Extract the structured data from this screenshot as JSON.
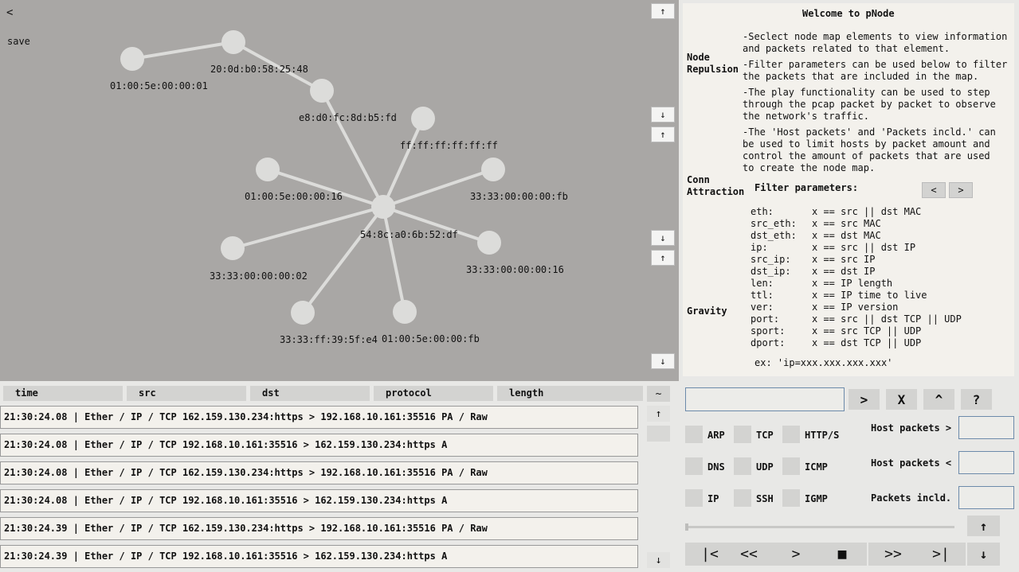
{
  "map": {
    "back_label": "<",
    "save_label": "save",
    "nodes": [
      {
        "id": "n1",
        "label": "01:00:5e:00:00:01"
      },
      {
        "id": "n2",
        "label": "20:0d:b0:58:25:48"
      },
      {
        "id": "n3",
        "label": "e8:d0:fc:8d:b5:fd"
      },
      {
        "id": "n4",
        "label": "ff:ff:ff:ff:ff:ff"
      },
      {
        "id": "n5",
        "label": "01:00:5e:00:00:16"
      },
      {
        "id": "n6",
        "label": "33:33:00:00:00:fb"
      },
      {
        "id": "n7",
        "label": "54:8c:a0:6b:52:df"
      },
      {
        "id": "n8",
        "label": "33:33:00:00:00:16"
      },
      {
        "id": "n9",
        "label": "33:33:00:00:00:02"
      },
      {
        "id": "n10",
        "label": "33:33:ff:39:5f:e4"
      },
      {
        "id": "n11",
        "label": "01:00:5e:00:00:fb"
      }
    ],
    "up_arrow": "↑",
    "down_arrow": "↓"
  },
  "info": {
    "title": "Welcome to pNode",
    "node_repulsion": "Node\nRepulsion",
    "conn_attraction": "Conn\nAttraction",
    "gravity": "Gravity",
    "bullets": [
      "-Seclect node map elements to view information\nand packets related to that element.",
      "-Filter parameters can be used below to filter\nthe packets that are included in the map.",
      "-The play functionality can be used to step\nthrough the pcap packet by packet to observe\nthe network's traffic.",
      "-The 'Host packets' and 'Packets incld.' can\nbe used to limit hosts by packet amount and\ncontrol the amount of packets that are used\nto create the node map."
    ],
    "filter_title": "Filter parameters:",
    "prev": "<",
    "next": ">",
    "filter_keys": "eth:\nsrc_eth:\ndst_eth:\nip:\nsrc_ip:\ndst_ip:\nlen:\nttl:\nver:\nport:\nsport:\ndport:",
    "filter_vals": "x == src || dst MAC\nx == src MAC\nx == dst MAC\nx == src || dst IP\nx == src IP\nx == dst IP\nx == IP length\nx == IP time to live\nx == IP version\nx == src || dst TCP || UDP\nx == src TCP || UDP\nx == dst TCP || UDP",
    "example": "ex: 'ip=xxx.xxx.xxx.xxx'"
  },
  "table": {
    "headers": [
      "time",
      "src",
      "dst",
      "protocol",
      "length"
    ],
    "collapse": "~",
    "rows": [
      "21:30:24.08 | Ether / IP / TCP 162.159.130.234:https > 192.168.10.161:35516 PA / Raw",
      "21:30:24.08 | Ether / IP / TCP 192.168.10.161:35516 > 162.159.130.234:https A",
      "21:30:24.08 | Ether / IP / TCP 162.159.130.234:https > 192.168.10.161:35516 PA / Raw",
      "21:30:24.08 | Ether / IP / TCP 192.168.10.161:35516 > 162.159.130.234:https A",
      "21:30:24.39 | Ether / IP / TCP 162.159.130.234:https > 192.168.10.161:35516 PA / Raw",
      "21:30:24.39 | Ether / IP / TCP 192.168.10.161:35516 > 162.159.130.234:https A"
    ],
    "up": "↑",
    "down": "↓"
  },
  "controls": {
    "filter_value": "",
    "apply": ">",
    "clear": "X",
    "caret": "^",
    "help": "?",
    "checks": [
      [
        "ARP",
        "TCP",
        "HTTP/S"
      ],
      [
        "DNS",
        "UDP",
        "ICMP"
      ],
      [
        "IP",
        "SSH",
        "IGMP"
      ]
    ],
    "host_gt": "Host packets >",
    "host_lt": "Host packets <",
    "pkts_incl": "Packets incld.",
    "play": [
      "|<",
      "<<",
      ">",
      "■",
      ">>",
      ">|"
    ],
    "up": "↑",
    "down": "↓"
  }
}
